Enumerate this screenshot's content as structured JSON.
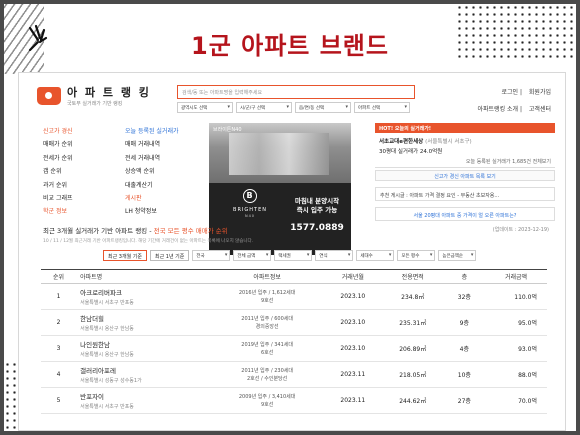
{
  "slide": {
    "title": "1군 아파트 브랜드"
  },
  "header": {
    "logo_text": "아 파 트 랭 킹",
    "logo_sub": "국토부 실거래가 기반 랭킹",
    "search_placeholder": "검색/동 또는 아파트명을 입력해주세요",
    "links": [
      "로그인",
      "회원가입"
    ],
    "links2": [
      "아파트랭킹 소개",
      "고객센터"
    ],
    "selects": [
      "광역시도 선택",
      "시/군/구 선택",
      "읍/면/동 선택",
      "아파트 선택"
    ]
  },
  "menu_a": [
    {
      "label": "신고가 경신",
      "style": "hl"
    },
    {
      "label": "매매가 순위",
      "style": ""
    },
    {
      "label": "전세가 순위",
      "style": ""
    },
    {
      "label": "갭 순위",
      "style": ""
    },
    {
      "label": "과거 순위",
      "style": ""
    },
    {
      "label": "비교 그래프",
      "style": ""
    },
    {
      "label": "학군 정보",
      "style": "hl"
    }
  ],
  "menu_b": [
    {
      "label": "오늘 등록된 실거래가",
      "style": "blue"
    },
    {
      "label": "매매 거래내역",
      "style": ""
    },
    {
      "label": "전세 거래내역",
      "style": ""
    },
    {
      "label": "상승액 순위",
      "style": ""
    },
    {
      "label": "대출계산기",
      "style": ""
    },
    {
      "label": "게시판",
      "style": "hl"
    },
    {
      "label": "LH 청약정보",
      "style": ""
    }
  ],
  "banner": {
    "label": "브라이튼N40",
    "brand": "BRIGHTEN",
    "brand_sub": "N40",
    "copy1": "마침내 분양시작",
    "copy2": "즉시 입주 가능",
    "phone": "1577.0889"
  },
  "right_panel": {
    "hot": "HOT! 오늘의 실거래가!",
    "line1_name": "서초교대e편한세상",
    "line1_loc": "(서울특별시 서초구)",
    "line2": "30평대 실거래가 24.0억원",
    "line3": "오늘 등록된 실거래가 1,685건 전체보기",
    "button": "신고가 경신 아파트 목록 보기",
    "box1": "추천 게시글 : 아파트 가격 결정 요인 - 부동산 초보자용...",
    "box2": "서울 20평대 아파트 중 가격이 얼 오른 아파트는?"
  },
  "section": {
    "title_prefix": "최근 3개월 실거래가 기반 아파트 랭킹 - ",
    "title_highlight": "전국 모든 평수 매매가 순위",
    "date": "(업데이트 : 2023-12-19)",
    "note": "10 / 11 / 12월 최근거래 기반 아파트랭킹입니다. 해당 기간에 거래건이 없는 아파트는 목록에 나오지 않습니다.",
    "filter_buttons": [
      "최근 3개월 기준",
      "최근 1년 기준"
    ],
    "filter_selects": [
      "전국",
      "전체 금액",
      "택세권",
      "연식",
      "세대수",
      "모든 평수",
      "높은금액순"
    ]
  },
  "table": {
    "headers": [
      "순위",
      "아파트명",
      "아파트정보",
      "거래년월",
      "전용면적",
      "층",
      "거래금액"
    ],
    "rows": [
      {
        "rank": "1",
        "name": "아크로리버파크",
        "loc": "서울특별시 서초구 반포동",
        "info1": "2016년 입주 / 1,612세대",
        "info2": "9호선",
        "ym": "2023.10",
        "area": "234.8㎡",
        "floor": "32층",
        "price": "110.0억"
      },
      {
        "rank": "2",
        "name": "한남더힐",
        "loc": "서울특별시 용산구 한남동",
        "info1": "2011년 입주 / 600세대",
        "info2": "경의중앙선",
        "ym": "2023.10",
        "area": "235.31㎡",
        "floor": "9층",
        "price": "95.0억"
      },
      {
        "rank": "3",
        "name": "나인원한남",
        "loc": "서울특별시 용산구 한남동",
        "info1": "2019년 입주 / 341세대",
        "info2": "6호선",
        "ym": "2023.10",
        "area": "206.89㎡",
        "floor": "4층",
        "price": "93.0억"
      },
      {
        "rank": "4",
        "name": "갤러리아포레",
        "loc": "서울특별시 성동구 성수동1가",
        "info1": "2011년 입주 / 230세대",
        "info2": "2호선 / 수인분당선",
        "ym": "2023.11",
        "area": "218.05㎡",
        "floor": "10층",
        "price": "88.0억"
      },
      {
        "rank": "5",
        "name": "반포자이",
        "loc": "서울특별시 서초구 반포동",
        "info1": "2009년 입주 / 3,410세대",
        "info2": "9호선",
        "ym": "2023.11",
        "area": "244.62㎡",
        "floor": "27층",
        "price": "70.0억"
      }
    ]
  }
}
